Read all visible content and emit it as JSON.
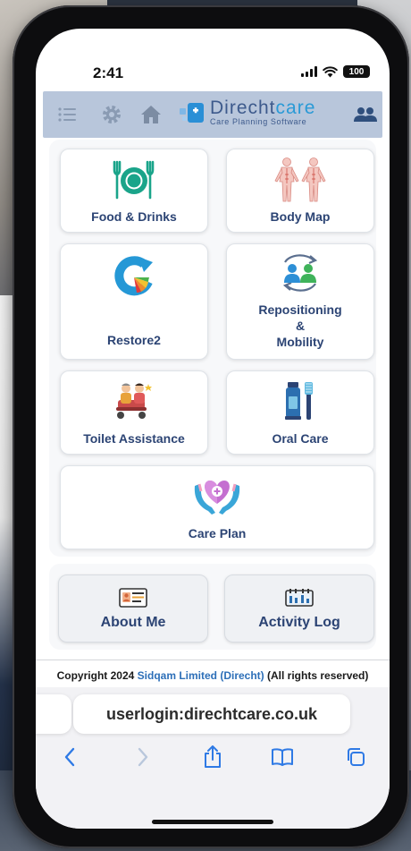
{
  "status_bar": {
    "time": "2:41",
    "battery": "100"
  },
  "app_bar": {
    "brand_part1": "Direcht",
    "brand_part2": "care",
    "brand_subtitle": "Care Planning Software",
    "icons": [
      "menu-icon",
      "gear-icon",
      "home-icon",
      "users-icon"
    ]
  },
  "tiles": [
    {
      "label": "Food & Drinks",
      "icon": "food-drinks-icon"
    },
    {
      "label": "Body Map",
      "icon": "body-map-icon"
    },
    {
      "label": "Restore2",
      "icon": "restore2-icon"
    },
    {
      "label_lines": [
        "Repositioning",
        "&",
        "Mobility"
      ],
      "icon": "repositioning-icon"
    },
    {
      "label": "Toilet Assistance",
      "icon": "toilet-assistance-icon"
    },
    {
      "label": "Oral Care",
      "icon": "oral-care-icon"
    },
    {
      "label": "Care Plan",
      "icon": "care-plan-icon"
    }
  ],
  "secondary_buttons": [
    {
      "label": "About Me",
      "icon": "id-card-icon"
    },
    {
      "label": "Activity Log",
      "icon": "activity-log-icon"
    }
  ],
  "footer": {
    "prefix": "Copyright 2024",
    "company": "Sidqam Limited (Direcht)",
    "suffix": "(All rights reserved)"
  },
  "browser": {
    "url": "userlogin:direchtcare.co.uk",
    "toolbar_icons": [
      "back-icon",
      "forward-icon",
      "share-icon",
      "bookmarks-icon",
      "tabs-icon"
    ]
  }
}
